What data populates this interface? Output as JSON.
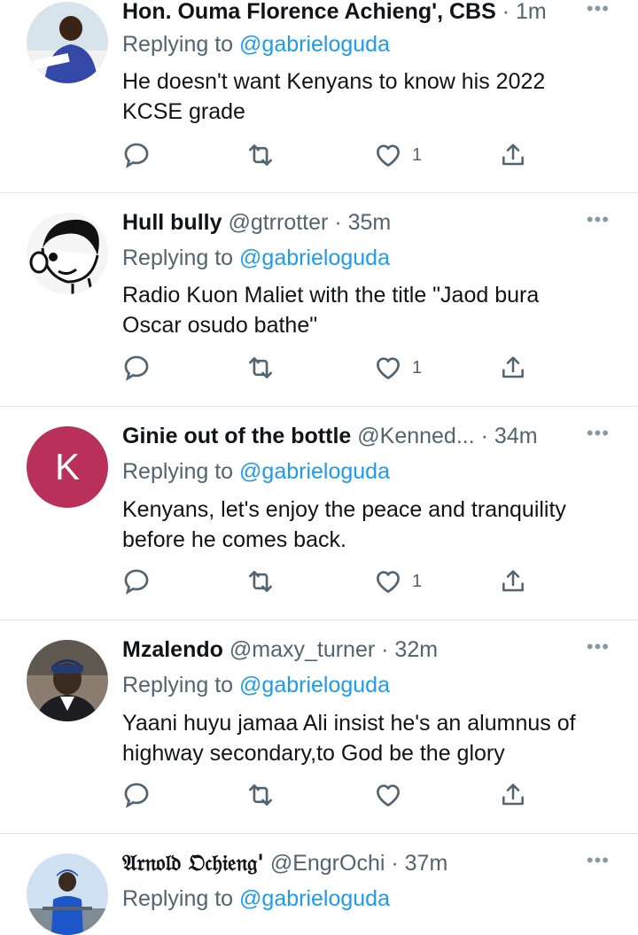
{
  "replying_label": "Replying to",
  "colors": {
    "text": "#0f1419",
    "secondary": "#536471",
    "link": "#1d9bf0",
    "divider": "#e1e6ea",
    "k_avatar_bg": "#b9305a"
  },
  "tweets": [
    {
      "name": "Hon. Ouma Florence Achieng', CBS",
      "handle": "",
      "time": "1m",
      "reply_to": "@gabrieloguda",
      "text": "He doesn't want Kenyans to know his 2022 KCSE grade",
      "likes": "1"
    },
    {
      "name": "Hull bully",
      "handle": "@gtrrotter",
      "time": "35m",
      "reply_to": "@gabrieloguda",
      "text": "Radio Kuon Maliet with the title \"Jaod bura Oscar osudo bathe\"",
      "likes": "1"
    },
    {
      "name": "Ginie out of the bottle",
      "handle": "@Kenned...",
      "time": "34m",
      "avatar_letter": "K",
      "reply_to": "@gabrieloguda",
      "text": "Kenyans, let's enjoy the peace and tranquility before he comes back.",
      "likes": "1"
    },
    {
      "name": "Mzalendo",
      "handle": "@maxy_turner",
      "time": "32m",
      "reply_to": "@gabrieloguda",
      "text": "Yaani huyu jamaa Ali insist he's an alumnus of highway secondary,to God be the glory",
      "likes": ""
    },
    {
      "name": "𝔄𝔯𝔫𝔬𝔩𝔡 𝔒𝔠𝔥𝔦𝔢𝔫𝔤'",
      "handle": "@EngrOchi",
      "time": "37m",
      "reply_to": "@gabrieloguda"
    }
  ]
}
